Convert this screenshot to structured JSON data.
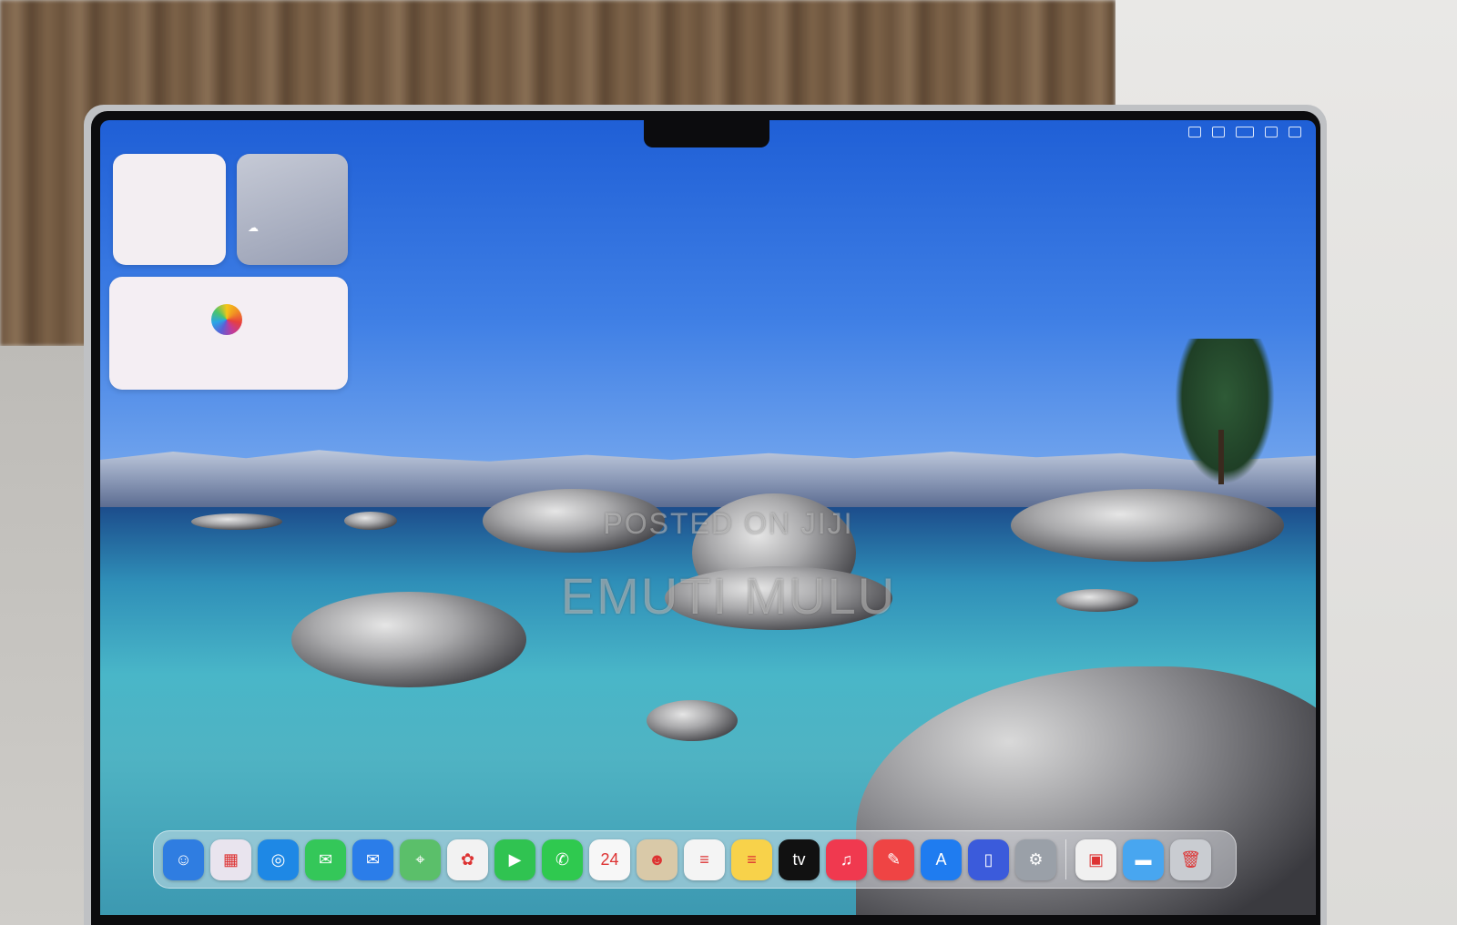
{
  "watermark": {
    "line1": "POSTED ON JIJI",
    "line2": "EMUTI MULU"
  },
  "dock": {
    "apps": [
      {
        "icon": "finder-icon",
        "color": "#2f7de1",
        "glyph": "☺"
      },
      {
        "icon": "launchpad-icon",
        "color": "#e9e4ee",
        "glyph": "▦"
      },
      {
        "icon": "safari-icon",
        "color": "#1e88e5",
        "glyph": "◎"
      },
      {
        "icon": "messages-icon",
        "color": "#34c759",
        "glyph": "✉"
      },
      {
        "icon": "mail-icon",
        "color": "#2b7de9",
        "glyph": "✉"
      },
      {
        "icon": "maps-icon",
        "color": "#5bbf6a",
        "glyph": "⌖"
      },
      {
        "icon": "photos-icon",
        "color": "#f2f2f2",
        "glyph": "✿"
      },
      {
        "icon": "facetime-icon",
        "color": "#30c351",
        "glyph": "▶"
      },
      {
        "icon": "phone-icon",
        "color": "#2fc94f",
        "glyph": "✆"
      },
      {
        "icon": "calendar-icon",
        "color": "#f7f7f7",
        "glyph": "24"
      },
      {
        "icon": "contacts-icon",
        "color": "#d9c9a8",
        "glyph": "☻"
      },
      {
        "icon": "reminders-icon",
        "color": "#f4f4f4",
        "glyph": "≡"
      },
      {
        "icon": "notes-icon",
        "color": "#f8d24a",
        "glyph": "≡"
      },
      {
        "icon": "tv-icon",
        "color": "#111111",
        "glyph": "tv"
      },
      {
        "icon": "music-icon",
        "color": "#f0394f",
        "glyph": "♫"
      },
      {
        "icon": "news-icon",
        "color": "#ef4444",
        "glyph": "✎"
      },
      {
        "icon": "app-store-icon",
        "color": "#1f7cf0",
        "glyph": "A"
      },
      {
        "icon": "iphone-mirroring-icon",
        "color": "#3b5bdb",
        "glyph": "▯"
      },
      {
        "icon": "system-settings-icon",
        "color": "#9aa0a8",
        "glyph": "⚙"
      },
      {
        "icon": "preview-icon",
        "color": "#f0f0f0",
        "glyph": "▣"
      },
      {
        "icon": "downloads-folder-icon",
        "color": "#48a6f0",
        "glyph": "▬"
      },
      {
        "icon": "trash-icon",
        "color": "#c9ccd1",
        "glyph": "🗑"
      }
    ]
  }
}
